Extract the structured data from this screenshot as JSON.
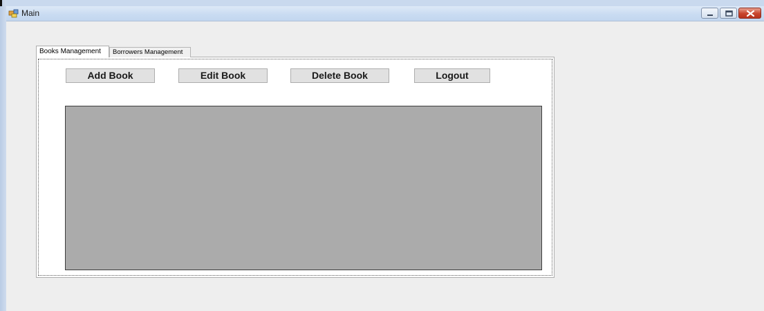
{
  "window": {
    "title": "Main",
    "icon": "app-icon"
  },
  "controls": {
    "minimize_icon": "minimize-icon",
    "maximize_icon": "maximize-icon",
    "close_icon": "close-icon"
  },
  "tabs": [
    {
      "label": "Books Management",
      "active": true
    },
    {
      "label": "Borrowers Management",
      "active": false
    }
  ],
  "toolbar": {
    "add_label": "Add Book",
    "edit_label": "Edit Book",
    "delete_label": "Delete Book",
    "logout_label": "Logout"
  },
  "colors": {
    "grid_background": "#ababab",
    "close_button": "#c8442c"
  }
}
